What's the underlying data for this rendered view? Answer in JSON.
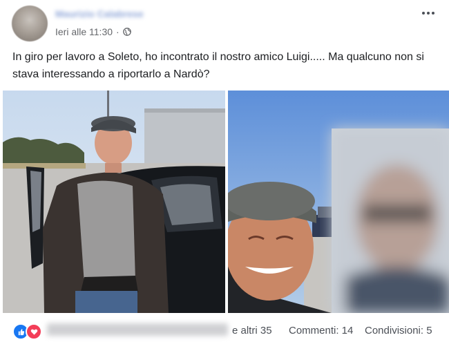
{
  "post": {
    "author": "Maurizio Calabrese",
    "time": "Ieri alle 11:30",
    "separator": "·",
    "audience_icon": "globe-icon",
    "text": "In giro per lavoro a Soleto, ho incontrato il nostro amico Luigi..... Ma qualcuno non si stava interessando a riportarlo a Nardò?",
    "more_icon": "more-options-icon"
  },
  "footer": {
    "reaction_icons": [
      "like-icon",
      "love-icon"
    ],
    "others": "e altri 35",
    "comments": "Commenti: 14",
    "shares": "Condivisioni: 5"
  },
  "colors": {
    "like": "#1877f2",
    "love": "#f33e58",
    "secondary_text": "#65676b"
  }
}
